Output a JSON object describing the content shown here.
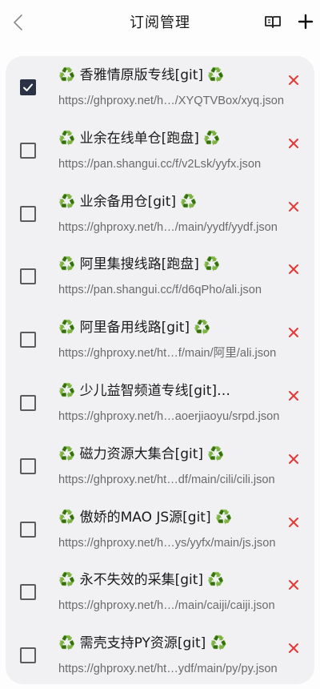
{
  "header": {
    "title": "订阅管理",
    "back_icon": "chevron-left",
    "book_icon": "book-open",
    "add_icon": "plus"
  },
  "colors": {
    "checkbox_checked": "#2b3246",
    "delete": "#e53935",
    "card_bg": "#f1f1f3"
  },
  "subscriptions": [
    {
      "name": "♻️ 香雅情原版专线[git] ♻️",
      "url": "https://ghproxy.net/h…/XYQTVBox/xyq.json",
      "checked": true
    },
    {
      "name": "♻️ 业余在线单仓[跑盘] ♻️",
      "url": "https://pan.shangui.cc/f/v2Lsk/yyfx.json",
      "checked": false
    },
    {
      "name": "♻️ 业余备用仓[git] ♻️",
      "url": "https://ghproxy.net/h…/main/yydf/yydf.json",
      "checked": false
    },
    {
      "name": "♻️ 阿里集搜线路[跑盘] ♻️",
      "url": "https://pan.shangui.cc/f/d6qPho/ali.json",
      "checked": false
    },
    {
      "name": "♻️ 阿里备用线路[git] ♻️",
      "url": "https://ghproxy.net/ht…f/main/阿里/ali.json",
      "checked": false
    },
    {
      "name": "♻️ 少儿益智频道专线[git]…",
      "url": "https://ghproxy.net/h…aoerjiaoyu/srpd.json",
      "checked": false
    },
    {
      "name": "♻️ 磁力资源大集合[git] ♻️",
      "url": "https://ghproxy.net/ht…df/main/cili/cili.json",
      "checked": false
    },
    {
      "name": "♻️ 傲娇的MAO JS源[git] ♻️",
      "url": "https://ghproxy.net/h…ys/yyfx/main/js.json",
      "checked": false
    },
    {
      "name": "♻️ 永不失效的采集[git] ♻️",
      "url": "https://ghproxy.net/h…/main/caiji/caiji.json",
      "checked": false
    },
    {
      "name": "♻️ 需壳支持PY资源[git] ♻️",
      "url": "https://ghproxy.net/ht…ydf/main/py/py.json",
      "checked": false
    }
  ]
}
